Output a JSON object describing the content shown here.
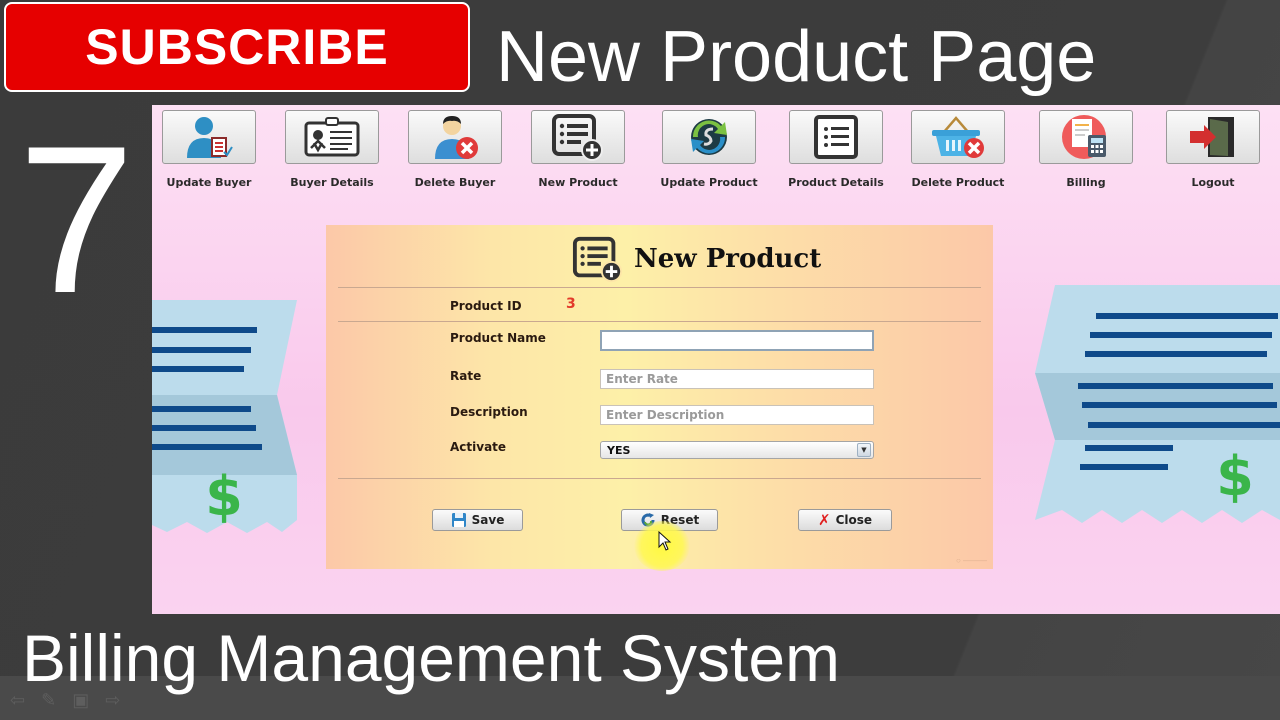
{
  "overlay": {
    "subscribe_label": "SUBSCRIBE",
    "page_title": "New Product Page",
    "episode_number": "7",
    "series_title": "Billing Management System",
    "colors": {
      "subscribe_red": "#e60000",
      "background": "#3a3a3a"
    }
  },
  "toolbar": {
    "items": [
      {
        "label": "Update Buyer",
        "icon": "update-buyer-icon"
      },
      {
        "label": "Buyer Details",
        "icon": "id-card-icon"
      },
      {
        "label": "Delete Buyer",
        "icon": "delete-user-icon"
      },
      {
        "label": "New Product",
        "icon": "list-add-icon"
      },
      {
        "label": "Update Product",
        "icon": "sync-icon"
      },
      {
        "label": "Product Details",
        "icon": "list-icon"
      },
      {
        "label": "Delete Product",
        "icon": "basket-delete-icon"
      },
      {
        "label": "Billing",
        "icon": "billing-calculator-icon"
      },
      {
        "label": "Logout",
        "icon": "logout-door-icon"
      }
    ]
  },
  "form": {
    "title": "New Product",
    "product_id_label": "Product ID",
    "product_id_value": "3",
    "product_name_label": "Product Name",
    "product_name_value": "",
    "rate_label": "Rate",
    "rate_placeholder": "Enter Rate",
    "description_label": "Description",
    "description_placeholder": "Enter Description",
    "activate_label": "Activate",
    "activate_value": "YES",
    "buttons": {
      "save": "Save",
      "reset": "Reset",
      "close": "Close"
    },
    "colors": {
      "product_id_value": "#e23a2a",
      "panel_center": "#fdf0a8",
      "panel_edge": "#fcc8a8",
      "app_bg": "#fad3f0"
    }
  }
}
